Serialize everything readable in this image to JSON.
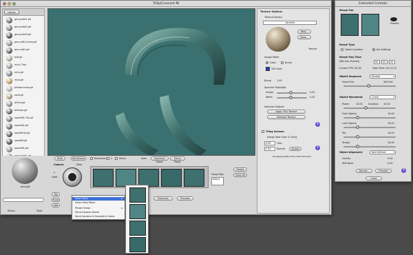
{
  "main_window": {
    "title": "TriSpiCrescent-NI",
    "library_label": "Library",
    "library_items": [
      {
        "name": "gen-jacket1.glt",
        "color": "#7a7a7a"
      },
      {
        "name": "gen-jacket2.glt",
        "color": "#8a8a8a"
      },
      {
        "name": "gen-jacket3.glt",
        "color": "#5a5a5a"
      },
      {
        "name": "gen-craft1-bump.glt",
        "color": "#9a9a9a"
      },
      {
        "name": "gen-craft1.glt",
        "color": "#6a6a6a"
      },
      {
        "name": "buff.glt",
        "color": "#b9b4a5"
      },
      {
        "name": "mica-7.fab",
        "color": "#a0a0a0"
      },
      {
        "name": "mica.glt",
        "color": "#8c8c8c"
      },
      {
        "name": "mica.glt",
        "color": "#c8a46a"
      },
      {
        "name": "pinkwe-bump.glt",
        "color": "#bdbdbd"
      },
      {
        "name": "sand.glt",
        "color": "#b8a890"
      },
      {
        "name": "bill'ine.glt",
        "color": "#9a9a9a"
      },
      {
        "name": "bill'ones.glt",
        "color": "#707070"
      },
      {
        "name": "spare461-7ds.glt",
        "color": "#8a8a8a"
      },
      {
        "name": "spare461.glt",
        "color": "#7a7a7a"
      },
      {
        "name": "spare89-bt.glt",
        "color": "#6a6a6a"
      },
      {
        "name": "spare89.glt",
        "color": "#5a5a5a"
      },
      {
        "name": "spare461.glt",
        "color": "#9a9a9a"
      },
      {
        "name": "gen-jacket1.glt",
        "color": "#8a8a8a"
      }
    ],
    "preview_caption": "mica.glt",
    "search_placeholder": "",
    "toolbar_labels": {
      "bulb": "Bulb",
      "wireframe": "Wireframe",
      "resolution": "Resolution",
      "two": "2",
      "mirror": "Mirror",
      "axes": "Axes",
      "selection_reset": "Selection Reset",
      "mirror_reset": "Mirror Reset"
    },
    "camera_label": "Camera",
    "camera_mode": "Orbit",
    "camera_axis": "Y",
    "camera_buttons": {
      "top": "Top",
      "front": "Front"
    },
    "slide_label": "Slide",
    "group_box_label": "Group Box",
    "group_box_value": "Select",
    "delete_label": "Delete",
    "clear_all_label": "Clear All",
    "status_label": "Status",
    "add_label": "Add",
    "selection_label": "Selection",
    "preview_label": "Preview",
    "tools_label": "Tools",
    "bottom_dropdown": "Slide"
  },
  "context_menu": {
    "items": [
      "View Stack",
      "Clear View Stack",
      "Preset Views",
      "Send Camera Home",
      "Send Camera & Geometry Home"
    ],
    "highlighted_index": 0,
    "submenu_arrow": "▸"
  },
  "texture_options": {
    "title": "Texture Options",
    "texture_basics": "Texture Basics",
    "texture_name": "sandrk4",
    "buttons": [
      "New...",
      "Save..."
    ],
    "texture_label": "Texture",
    "assign_mode": "Assign Mode",
    "assign_opts": [
      "Color",
      "Bump"
    ],
    "tile_color": "Tile Color",
    "bump_label": "Bump",
    "bump_value": "1.00",
    "specular_label": "Specular Highlight",
    "specular_rows": [
      {
        "label": "Height",
        "value": "0.20"
      },
      {
        "label": "Width",
        "value": "0.20"
      }
    ],
    "selected_objects": "Selected Objects",
    "apply_btn": "Apply This Texture",
    "remove_btn": "Remove Texture",
    "tiling_label": "Tiling Scheme",
    "assign_new": "Assign New Color & Tiling",
    "tiling_value_1": "4.00",
    "tiling_value_2": "2.50",
    "tiles_label": "Tiles",
    "normal_label": "Normal",
    "across_label": "Across",
    "footer": "Remapping Map Extra Tiles Elements"
  },
  "extended_controls": {
    "title": "Extended Controls",
    "morph_pair": "Morph Pair",
    "presets_label": "Presets",
    "morph_type": "Morph Type",
    "morph_opts": [
      "Object Location",
      "Act Settings"
    ],
    "morph_time": "Morph Play Time",
    "time_caption": "(Min:Sec:Frames)",
    "time_fields": [
      "00",
      "00",
      "00"
    ],
    "current_fps": "Current FPS: 30.00",
    "total_time": "Total Time: 00:11:10",
    "object_sequence": "Object Sequence",
    "sequence_value": "Normal",
    "head_first": "Head First",
    "tail_first": "Tail First",
    "object_movement": "Object Movement",
    "movement_value": "Linear",
    "duration_rows": [
      {
        "label": "Power",
        "value": "10.00",
        "label2": "Duration",
        "value2": "10.00"
      },
      {
        "label": "First Objects",
        "value": "10.00"
      },
      {
        "label": "Last Objects",
        "value": "10.00"
      },
      {
        "label": "Tail",
        "value": "10.00"
      },
      {
        "label": "Tempo",
        "value": "10.00"
      }
    ],
    "alignment_label": "Object Alignment",
    "alignment_value": "Not Defined",
    "gravity_label": "Gravity",
    "gravity_value": "0.00",
    "stiffness_label": "Stiff Base",
    "stiffness_value": "0.00",
    "record_btn": "Record...",
    "preview_btn": "Preview",
    "close_btn": "Close"
  },
  "colors": {
    "viewport": "#3a7070",
    "accent": "#3c6ed6",
    "tile_color": "#1f3fcf"
  }
}
